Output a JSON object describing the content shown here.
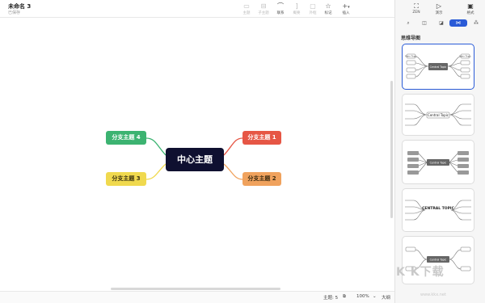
{
  "doc": {
    "title": "未命名 3",
    "status": "已保存"
  },
  "toolbar": {
    "items": [
      {
        "label": "主题",
        "icon": "topic-icon",
        "glyph": "▭",
        "enabled": false
      },
      {
        "label": "子主题",
        "icon": "subtopic-icon",
        "glyph": "⊟",
        "enabled": false
      },
      {
        "label": "联系",
        "icon": "relationship-icon",
        "glyph": "⌒",
        "enabled": true
      },
      {
        "label": "概要",
        "icon": "summary-icon",
        "glyph": "]",
        "enabled": false
      },
      {
        "label": "外框",
        "icon": "boundary-icon",
        "glyph": "▢",
        "enabled": false
      },
      {
        "label": "标记",
        "icon": "marker-icon",
        "glyph": "☆",
        "enabled": true
      },
      {
        "label": "插入",
        "icon": "insert-icon",
        "glyph": "+",
        "enabled": true,
        "dropdown": true
      }
    ]
  },
  "right_toolbar": {
    "items": [
      {
        "label": "ZEN",
        "icon": "zen-icon",
        "glyph": "⛶"
      },
      {
        "label": "演示",
        "icon": "present-icon",
        "glyph": "▷"
      },
      {
        "label": "格式",
        "icon": "format-panel-icon",
        "glyph": "▣",
        "active": true
      }
    ]
  },
  "panel": {
    "tabs": [
      {
        "name": "search",
        "glyph": "⌕"
      },
      {
        "name": "image",
        "glyph": "◫"
      },
      {
        "name": "sticker",
        "glyph": "◪"
      },
      {
        "name": "structure",
        "glyph": "⋈",
        "active": true
      },
      {
        "name": "theme",
        "glyph": "⁂"
      }
    ],
    "section_title": "思维导图",
    "template_label_central": "Central Topic",
    "template_label_main": "Main Topic",
    "template_label_central_upper": "CENTRAL TOPIC"
  },
  "map": {
    "central": "中心主题",
    "branches": [
      {
        "label": "分支主题 1",
        "color": "#e65645"
      },
      {
        "label": "分支主题 2",
        "color": "#f0a25d"
      },
      {
        "label": "分支主题 3",
        "color": "#f0d94e"
      },
      {
        "label": "分支主题 4",
        "color": "#3cb371"
      }
    ]
  },
  "statusbar": {
    "topic_count": "主题: 5",
    "zoom": "100%",
    "outline": "大纲"
  },
  "watermark": {
    "main": "K K下载",
    "sub": "www.kkx.net"
  },
  "colors": {
    "accent": "#2a5bd7",
    "central": "#0f1030"
  }
}
